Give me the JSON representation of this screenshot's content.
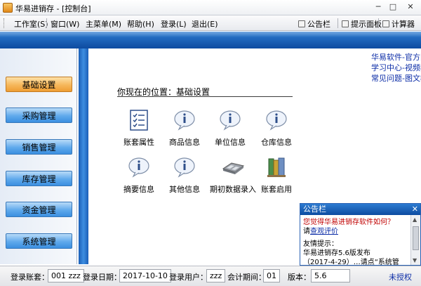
{
  "window": {
    "title": "华易进销存 - [控制台]",
    "controls": {
      "minimize": "─",
      "maximize": "□",
      "close": "✕"
    }
  },
  "menu": {
    "items": [
      "工作室(S)",
      "窗口(W)",
      "主菜单(M)",
      "帮助(H)",
      "登录(L)",
      "退出(E)"
    ],
    "tools": [
      "公告栏",
      "提示面板",
      "计算器"
    ]
  },
  "sidebar": {
    "items": [
      {
        "label": "基础设置",
        "active": true
      },
      {
        "label": "采购管理",
        "active": false
      },
      {
        "label": "销售管理",
        "active": false
      },
      {
        "label": "库存管理",
        "active": false
      },
      {
        "label": "资金管理",
        "active": false
      },
      {
        "label": "系统管理",
        "active": false
      }
    ]
  },
  "links": [
    "华易软件-官方网站",
    "学习中心-视频教程",
    "常见问题-图文教程"
  ],
  "breadcrumb": "你现在的位置：基础设置",
  "modules": [
    {
      "label": "账套属性",
      "icon": "checklist-icon"
    },
    {
      "label": "商品信息",
      "icon": "info-bubble-icon"
    },
    {
      "label": "单位信息",
      "icon": "info-bubble-icon"
    },
    {
      "label": "仓库信息",
      "icon": "info-bubble-icon"
    },
    {
      "label": "摘要信息",
      "icon": "info-bubble-icon"
    },
    {
      "label": "其他信息",
      "icon": "info-bubble-icon"
    },
    {
      "label": "期初数据录入",
      "icon": "calculator-icon"
    },
    {
      "label": "账套启用",
      "icon": "books-icon"
    }
  ],
  "notice": {
    "title": "公告栏",
    "question": "您觉得华易进销存软件如何？",
    "prompt_prefix": "请",
    "prompt_link": "查观评价",
    "tip_title": "友情提示：",
    "tip_line1": "华易进销存5.6版发布",
    "tip_line2": "（2017-4-29）…请点“系统管"
  },
  "status": {
    "account_label": "登录账套：",
    "account_value": "001 zzz",
    "date_label": "登录日期：",
    "date_value": "2017-10-10",
    "user_label": "登录用户：",
    "user_value": "zzz",
    "period_label": "会计期间：",
    "period_value": "01",
    "version_label": "版本：",
    "version_value": "5.6",
    "license": "未授权"
  },
  "colors": {
    "accent_blue": "#0d4ba0",
    "sidebar_button": "#5fa9ec",
    "sidebar_active": "#f6b75b",
    "link": "#0b2ca7"
  }
}
